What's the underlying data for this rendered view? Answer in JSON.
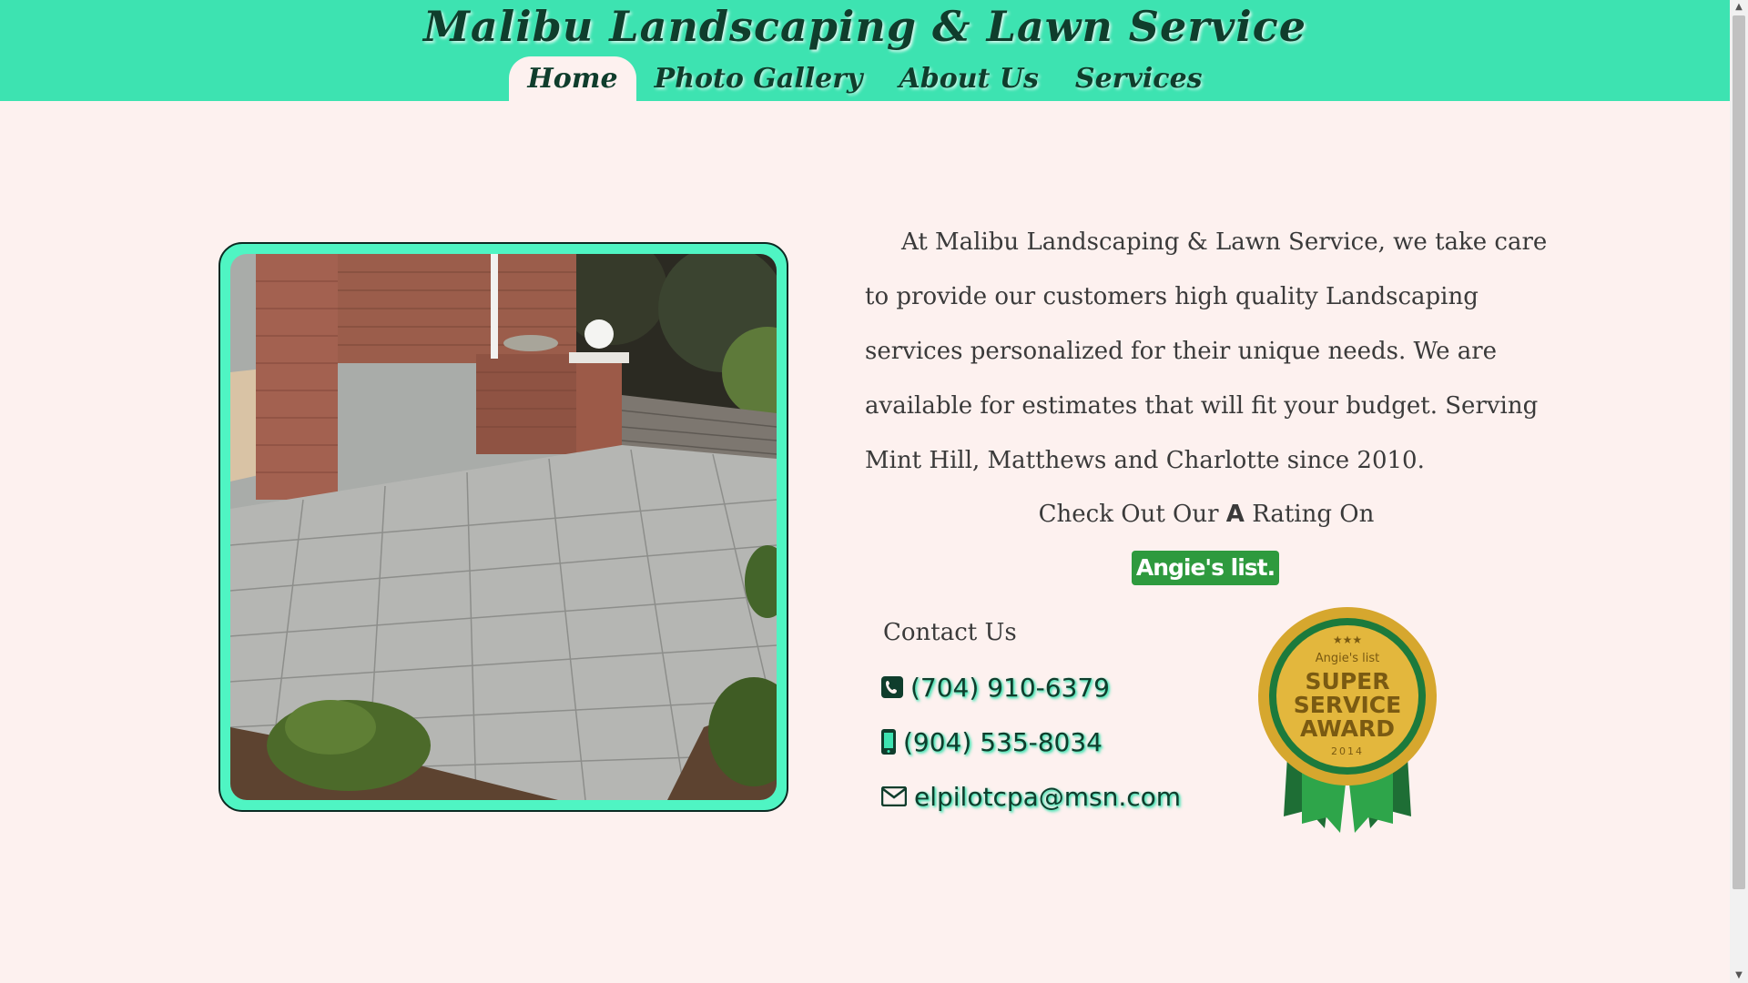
{
  "site": {
    "title": "Malibu Landscaping & Lawn Service"
  },
  "nav": {
    "items": [
      {
        "label": "Home",
        "active": true
      },
      {
        "label": "Photo Gallery",
        "active": false
      },
      {
        "label": "About Us",
        "active": false
      },
      {
        "label": "Services",
        "active": false
      }
    ]
  },
  "about": {
    "text": "At Malibu Landscaping & Lawn Service, we take care to provide our customers high quality Landscaping services personalized for their unique needs. We are available for estimates that will fit your budget. Serving Mint Hill, Matthews and Charlotte since 2010."
  },
  "rating": {
    "prefix": "Check Out Our",
    "grade": "A",
    "suffix": "Rating On",
    "logo_text": "Angie's list."
  },
  "contact": {
    "title": "Contact Us",
    "phone": "(704) 910-6379",
    "mobile": "(904) 535-8034",
    "email": "elpilotcpa@msn.com"
  },
  "award": {
    "brand": "Angie's list",
    "line1": "SUPER",
    "line2": "SERVICE",
    "line3": "AWARD",
    "year": "2014"
  },
  "colors": {
    "header_bg": "#3de3b1",
    "page_bg": "#fdf1ef",
    "dark_green": "#0f3d2c",
    "angies_green": "#2e9a3e"
  },
  "icons": {
    "phone": "phone-square-icon",
    "mobile": "mobile-icon",
    "email": "envelope-icon"
  }
}
